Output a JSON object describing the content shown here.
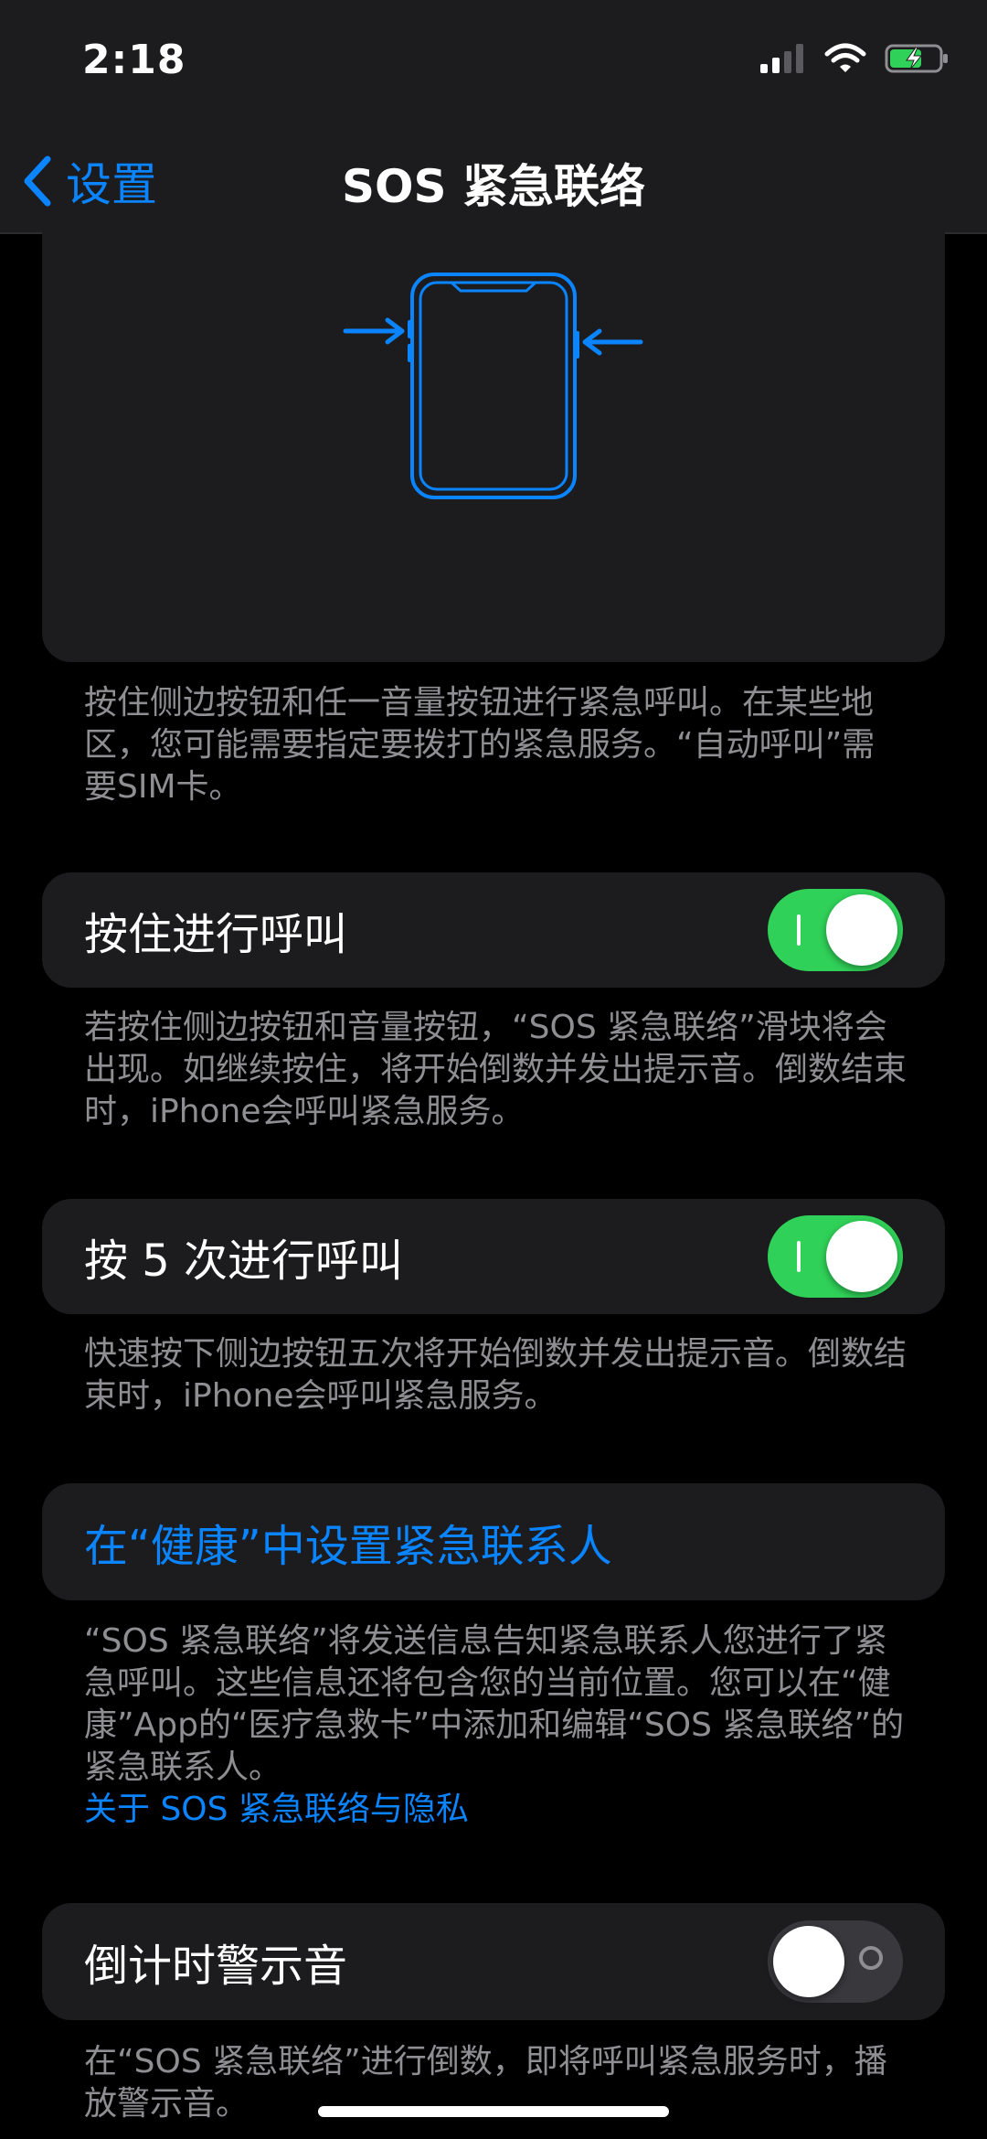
{
  "status": {
    "time": "2:18"
  },
  "nav": {
    "back_label": "设置",
    "title": "SOS 紧急联络"
  },
  "illustration_note": "按住侧边按钮和任一音量按钮进行紧急呼叫。在某些地区，您可能需要指定要拨打的紧急服务。“自动呼叫”需要SIM卡。",
  "hold_to_call": {
    "label": "按住进行呼叫",
    "enabled": true,
    "note": "若按住侧边按钮和音量按钮，“SOS 紧急联络”滑块将会出现。如继续按住，将开始倒数并发出提示音。倒数结束时，iPhone会呼叫紧急服务。"
  },
  "press5_to_call": {
    "label": "按 5 次进行呼叫",
    "enabled": true,
    "note": "快速按下侧边按钮五次将开始倒数并发出提示音。倒数结束时，iPhone会呼叫紧急服务。"
  },
  "health_contacts": {
    "label": "在“健康”中设置紧急联系人",
    "note": "“SOS 紧急联络”将发送信息告知紧急联系人您进行了紧急呼叫。这些信息还将包含您的当前位置。您可以在“健康”App的“医疗急救卡”中添加和编辑“SOS 紧急联络”的紧急联系人。",
    "privacy_link": "关于 SOS 紧急联络与隐私"
  },
  "countdown_sound": {
    "label": "倒计时警示音",
    "enabled": false,
    "note": "在“SOS 紧急联络”进行倒数，即将呼叫紧急服务时，播放警示音。"
  },
  "colors": {
    "accent": "#0a84ff",
    "toggle_on": "#30d158",
    "background": "#000000",
    "card": "#1c1c1e"
  },
  "icons": [
    "cellular-signal-icon",
    "wifi-icon",
    "battery-charging-icon",
    "chevron-left-icon"
  ]
}
